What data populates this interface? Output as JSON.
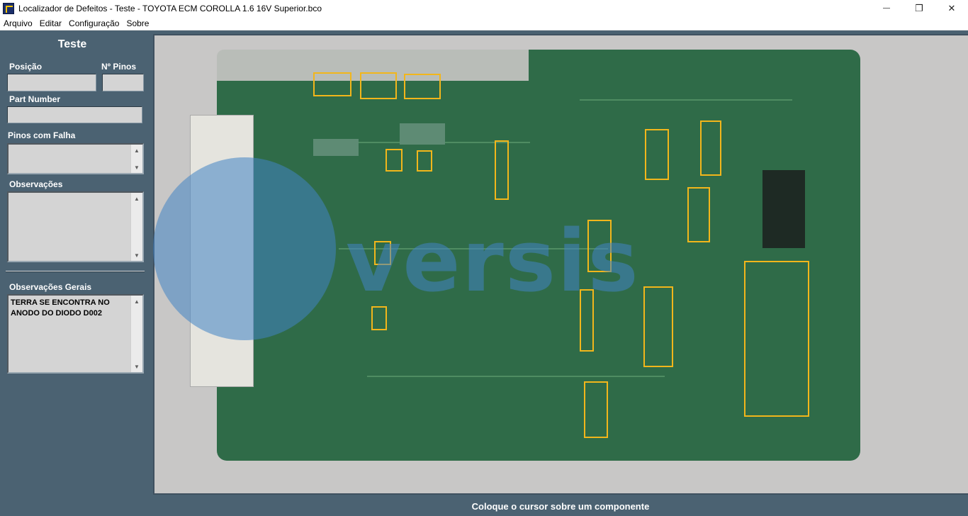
{
  "window": {
    "title": "Localizador de Defeitos - Teste - TOYOTA ECM COROLLA 1.6 16V Superior.bco",
    "minimize_label": "",
    "restore_label": "❐",
    "close_label": "✕"
  },
  "menu": {
    "items": [
      "Arquivo",
      "Editar",
      "Configuração",
      "Sobre"
    ]
  },
  "left_panel": {
    "title": "Teste",
    "position_label": "Posição",
    "position_value": "",
    "pins_label": "Nº Pinos",
    "pins_value": "",
    "part_number_label": "Part Number",
    "part_number_value": "",
    "failed_pins_label": "Pinos com Falha",
    "failed_pins_value": "",
    "observations_label": "Observações",
    "observations_value": "",
    "general_observations_label": "Observações Gerais",
    "general_observations_value": "TERRA SE ENCONTRA NO ANODO DO DIODO D002"
  },
  "board": {
    "watermark": "versis",
    "highlight_color": "#f2b61b",
    "board_color": "#2f6b48"
  },
  "status": {
    "text": "Coloque o cursor sobre um componente"
  }
}
